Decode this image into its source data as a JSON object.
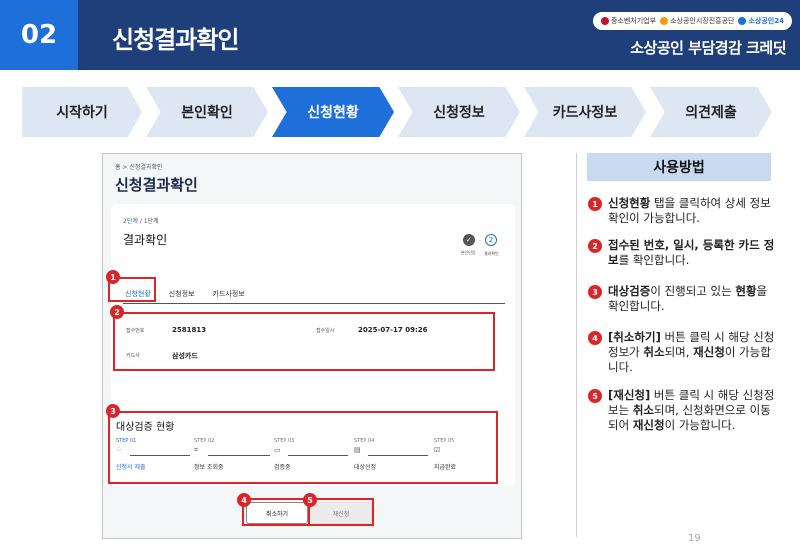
{
  "header": {
    "section_number": "02",
    "title": "신청결과확인",
    "brand": "소상공인 부담경감 크레딧",
    "orgs": [
      "중소벤처기업부",
      "소상공인시장진흥공단",
      "소상공인24"
    ]
  },
  "steps": [
    {
      "label": "시작하기",
      "active": false
    },
    {
      "label": "본인확인",
      "active": false
    },
    {
      "label": "신청현황",
      "active": true
    },
    {
      "label": "신청정보",
      "active": false
    },
    {
      "label": "카드사정보",
      "active": false
    },
    {
      "label": "의견제출",
      "active": false
    }
  ],
  "screenshot": {
    "breadcrumb": "홈 > 신청결과확인",
    "title": "신청결과확인",
    "step_current": "2단계",
    "step_total": "/ 1단계",
    "card_title": "결과확인",
    "mini_steps": [
      {
        "num": "✓",
        "label": "본인인증"
      },
      {
        "num": "2",
        "label": "결과확인"
      }
    ],
    "tabs": [
      "신청현황",
      "신청정보",
      "카드사정보"
    ],
    "info": {
      "receipt_label": "접수번호",
      "receipt_value": "2581813",
      "date_label": "접수일시",
      "date_value": "2025-07-17 09:26",
      "card_label": "카드사",
      "card_value": "삼성카드"
    },
    "verify_title": "대상검증 현황",
    "pipeline": [
      {
        "step": "STEP 01",
        "label": "신청서 제출",
        "active": true
      },
      {
        "step": "STEP 02",
        "label": "정보 조회중",
        "active": false
      },
      {
        "step": "STEP 03",
        "label": "검증중",
        "active": false
      },
      {
        "step": "STEP 04",
        "label": "대상선정",
        "active": false
      },
      {
        "step": "STEP 05",
        "label": "지급완료",
        "active": false
      }
    ],
    "buttons": {
      "cancel": "취소하기",
      "reapply": "재신청"
    },
    "badges": [
      "1",
      "2",
      "3",
      "4",
      "5"
    ]
  },
  "usage": {
    "title": "사용방법",
    "notes": [
      {
        "num": "1",
        "segments": [
          {
            "t": "신청현황",
            "b": true
          },
          {
            "t": " 탭을 클릭하여 상세 정보 확인이 가능합니다.",
            "b": false
          }
        ]
      },
      {
        "num": "2",
        "segments": [
          {
            "t": "접수된 번호, 일시, 등록한 카드 정보",
            "b": true
          },
          {
            "t": "를 확인합니다.",
            "b": false
          }
        ]
      },
      {
        "num": "3",
        "segments": [
          {
            "t": "대상검증",
            "b": true
          },
          {
            "t": "이 진행되고 있는 ",
            "b": false
          },
          {
            "t": "현황",
            "b": true
          },
          {
            "t": "을 확인합니다.",
            "b": false
          }
        ]
      },
      {
        "num": "4",
        "segments": [
          {
            "t": "[취소하기]",
            "b": true
          },
          {
            "t": " 버튼 클릭 시 해당 신청 정보가 ",
            "b": false
          },
          {
            "t": "취소",
            "b": true
          },
          {
            "t": "되며, ",
            "b": false
          },
          {
            "t": "재신청",
            "b": true
          },
          {
            "t": "이 가능합니다.",
            "b": false
          }
        ]
      },
      {
        "num": "5",
        "segments": [
          {
            "t": "[재신청]",
            "b": true
          },
          {
            "t": " 버튼 클릭 시 해당 신청정보는 ",
            "b": false
          },
          {
            "t": "취소",
            "b": true
          },
          {
            "t": "되며, 신청화면으로 이동되어 ",
            "b": false
          },
          {
            "t": "재신청",
            "b": true
          },
          {
            "t": "이 가능합니다.",
            "b": false
          }
        ]
      }
    ]
  },
  "page_number": "19",
  "colors": {
    "navy": "#1f3f7a",
    "blue": "#1e6fd9",
    "red": "#d8262b",
    "step_bg": "#dde7f4"
  }
}
